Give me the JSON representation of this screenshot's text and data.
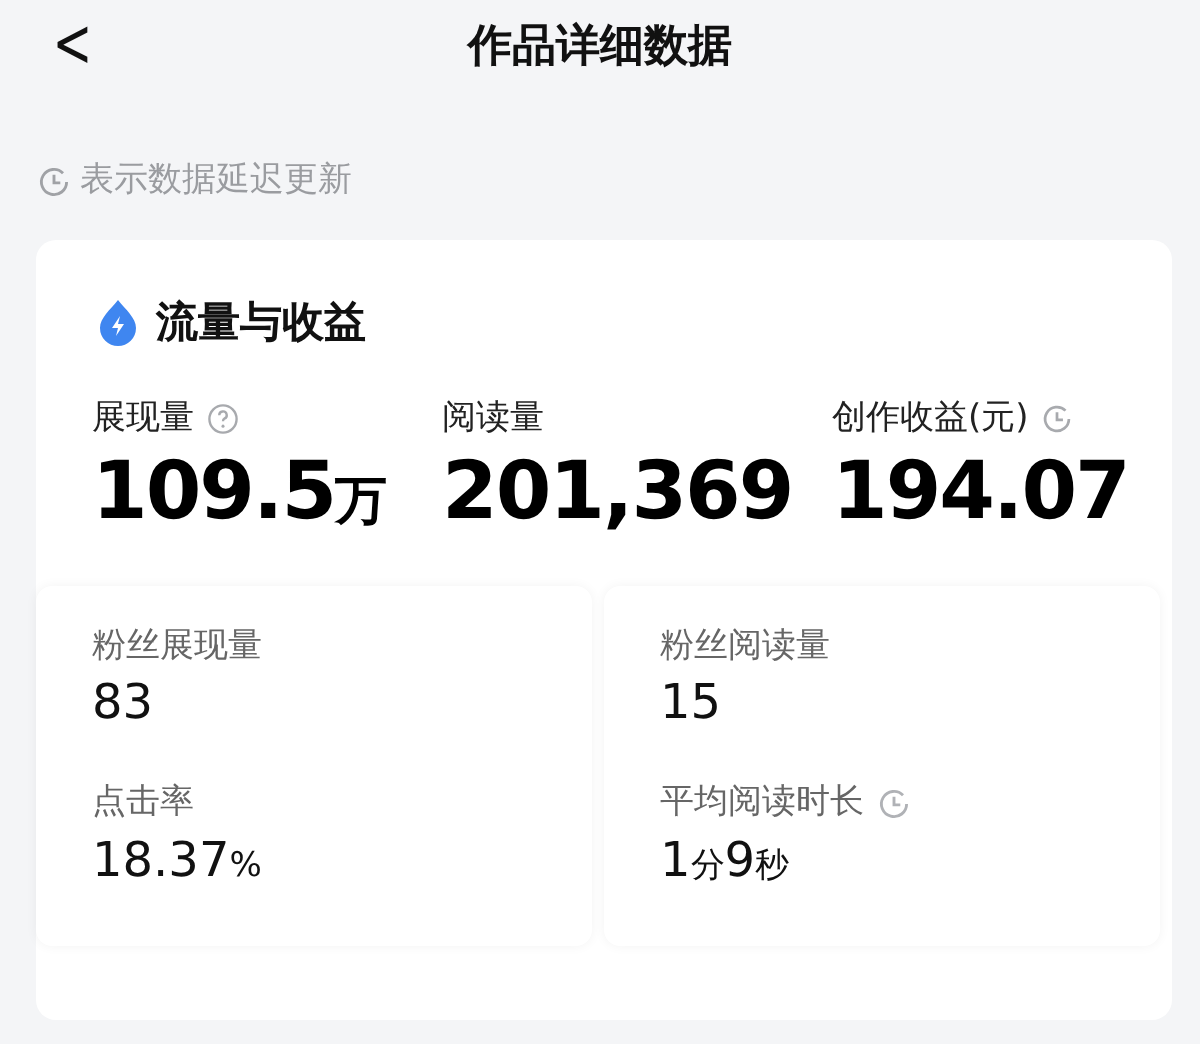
{
  "header": {
    "back": "<",
    "title": "作品详细数据"
  },
  "note": {
    "text": "表示数据延迟更新"
  },
  "section": {
    "title": "流量与收益",
    "main_stats": [
      {
        "label": "展现量",
        "kind": "help",
        "value": [
          {
            "text": "109.5",
            "kind": "num"
          },
          {
            "text": "万",
            "kind": "unit"
          }
        ]
      },
      {
        "label": "阅读量",
        "kind": "plain",
        "value": [
          {
            "text": "201,369",
            "kind": "num"
          }
        ]
      },
      {
        "label": "创作收益(元)",
        "kind": "delayed",
        "value": [
          {
            "text": "194.07",
            "kind": "num"
          }
        ]
      }
    ],
    "sub_panels": [
      {
        "stats": [
          {
            "label": "粉丝展现量",
            "kind": "plain",
            "value": [
              {
                "text": "83",
                "kind": "num"
              }
            ]
          },
          {
            "label": "点击率",
            "kind": "plain",
            "value": [
              {
                "text": "18.37",
                "kind": "num"
              },
              {
                "text": "%",
                "kind": "unit"
              }
            ]
          }
        ]
      },
      {
        "stats": [
          {
            "label": "粉丝阅读量",
            "kind": "plain",
            "value": [
              {
                "text": "15",
                "kind": "num"
              }
            ]
          },
          {
            "label": "平均阅读时长",
            "kind": "delayed",
            "value": [
              {
                "text": "1",
                "kind": "num"
              },
              {
                "text": "分",
                "kind": "unit"
              },
              {
                "text": "9",
                "kind": "num"
              },
              {
                "text": "秒",
                "kind": "unit"
              }
            ]
          }
        ]
      }
    ]
  }
}
